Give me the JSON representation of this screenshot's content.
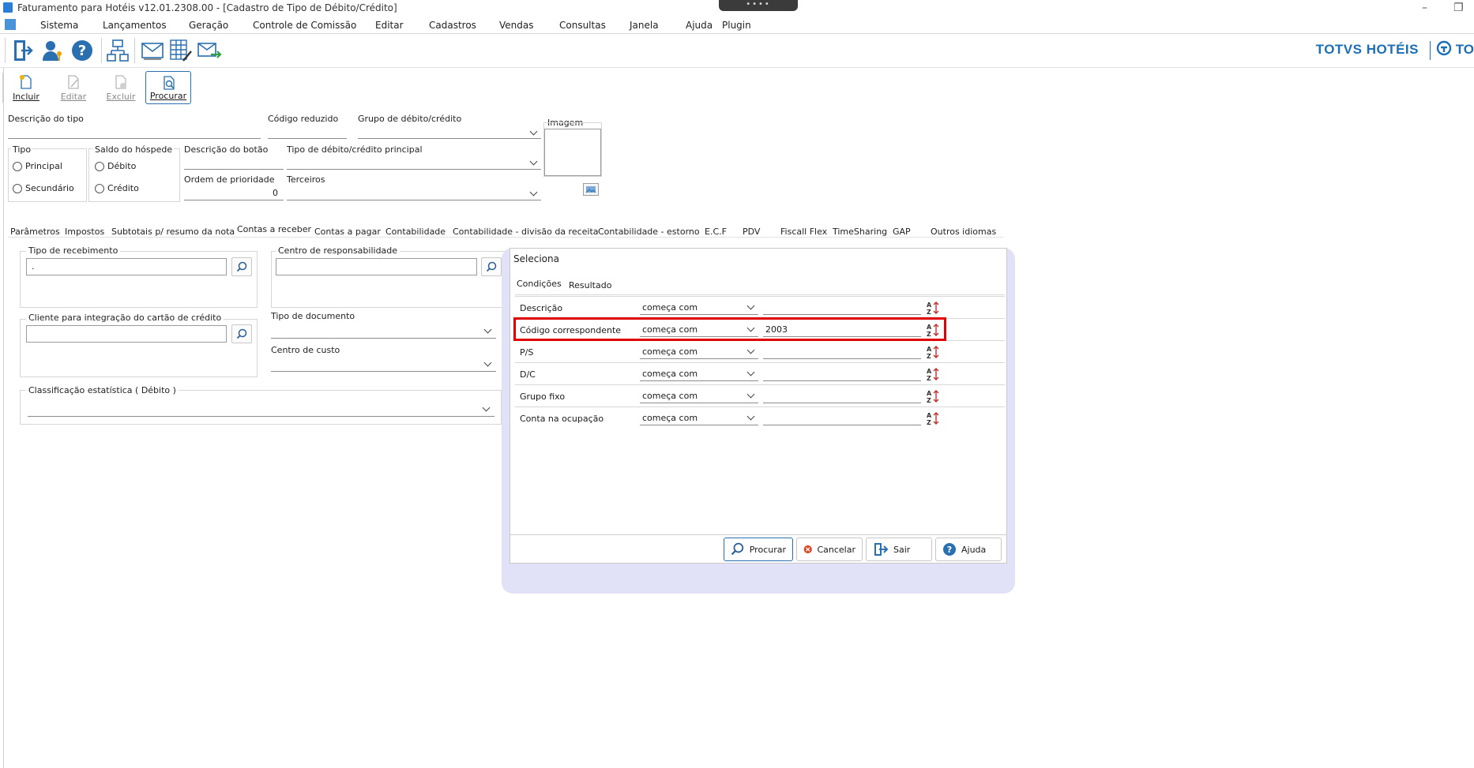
{
  "window": {
    "title": "Faturamento para Hotéis v12.01.2308.00 - [Cadastro de Tipo de Débito/Crédito]"
  },
  "menu": [
    "Sistema",
    "Lançamentos",
    "Geração",
    "Controle de Comissão",
    "Editar",
    "Cadastros",
    "Vendas",
    "Consultas",
    "Janela",
    "Ajuda",
    "Plugin"
  ],
  "brand": {
    "name": "TOTVS HOTÉIS",
    "name2": "TO"
  },
  "actions": {
    "include": "Incluir",
    "edit": "Editar",
    "delete": "Excluir",
    "search": "Procurar"
  },
  "form": {
    "desc_tipo": "Descrição do tipo",
    "codigo_reduzido": "Código reduzido",
    "grupo_debito_credito": "Grupo de débito/crédito",
    "imagem": "Imagem",
    "tipo": {
      "label": "Tipo",
      "options": [
        "Principal",
        "Secundário"
      ]
    },
    "saldo_hospede": {
      "label": "Saldo do hóspede",
      "options": [
        "Débito",
        "Crédito"
      ]
    },
    "descricao_botao": "Descrição do botão",
    "tipo_principal": "Tipo de débito/crédito principal",
    "ordem_prioridade": {
      "label": "Ordem de prioridade",
      "value": "0"
    },
    "terceiros": "Terceiros"
  },
  "tabs": [
    "Parâmetros",
    "Impostos",
    "Subtotais p/ resumo da nota",
    "Contas a receber",
    "Contas a pagar",
    "Contabilidade",
    "Contabilidade - divisão da receita",
    "Contabilidade - estorno",
    "E.C.F",
    "PDV",
    "Fiscall Flex",
    "TimeSharing",
    "GAP",
    "Outros idiomas"
  ],
  "receber": {
    "tipo_recebimento": {
      "label": "Tipo de recebimento",
      "value": "."
    },
    "centro_resp": {
      "label": "Centro de responsabilidade",
      "value": ""
    },
    "cliente_cartao": {
      "label": "Cliente para integração do cartão de crédito",
      "value": ""
    },
    "tipo_documento": "Tipo de documento",
    "centro_custo": "Centro de custo",
    "classificacao": "Classificação estatística ( Débito )"
  },
  "dialog": {
    "title": "Seleciona",
    "tabs": [
      "Condições",
      "Resultado"
    ],
    "rows": [
      {
        "label": "Descrição",
        "op": "começa com",
        "value": ""
      },
      {
        "label": "Código correspondente",
        "op": "começa com",
        "value": "2003"
      },
      {
        "label": "P/S",
        "op": "começa com",
        "value": ""
      },
      {
        "label": "D/C",
        "op": "começa com",
        "value": ""
      },
      {
        "label": "Grupo fixo",
        "op": "começa com",
        "value": ""
      },
      {
        "label": "Conta na ocupação",
        "op": "começa com",
        "value": ""
      }
    ],
    "buttons": {
      "search": "Procurar",
      "cancel": "Cancelar",
      "exit": "Sair",
      "help": "Ajuda"
    }
  },
  "colors": {
    "accent": "#2a6fb0",
    "highlight": "#e00000",
    "brand": "#1c6fb5",
    "shadow": "#e1e1f7"
  }
}
